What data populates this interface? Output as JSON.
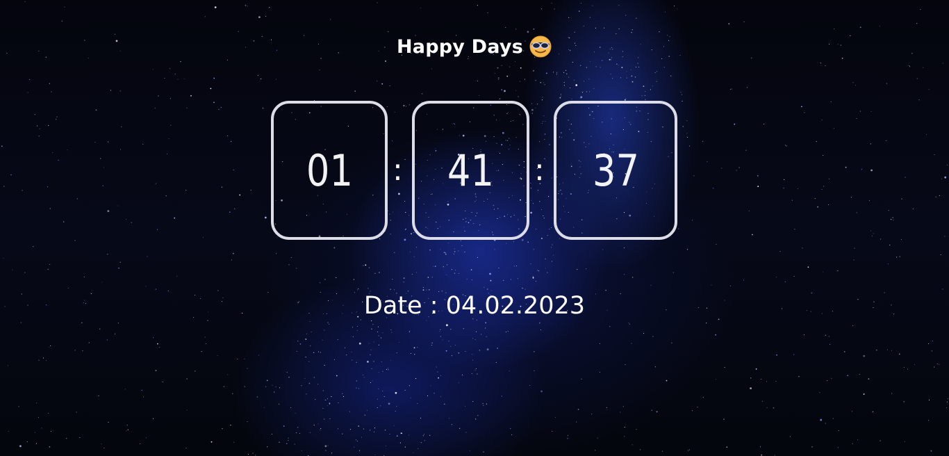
{
  "header": {
    "title": "Happy Days",
    "emoji_icon": "smiling-face-with-sunglasses-icon"
  },
  "clock": {
    "hours": "01",
    "minutes": "41",
    "seconds": "37",
    "separator": ":"
  },
  "date": {
    "label": "Date",
    "separator": ":",
    "value": "04.02.2023"
  },
  "colors": {
    "background": "#05070f",
    "nebula": "#2846d2",
    "box_border": "#dcdde6",
    "text": "#ffffff"
  }
}
